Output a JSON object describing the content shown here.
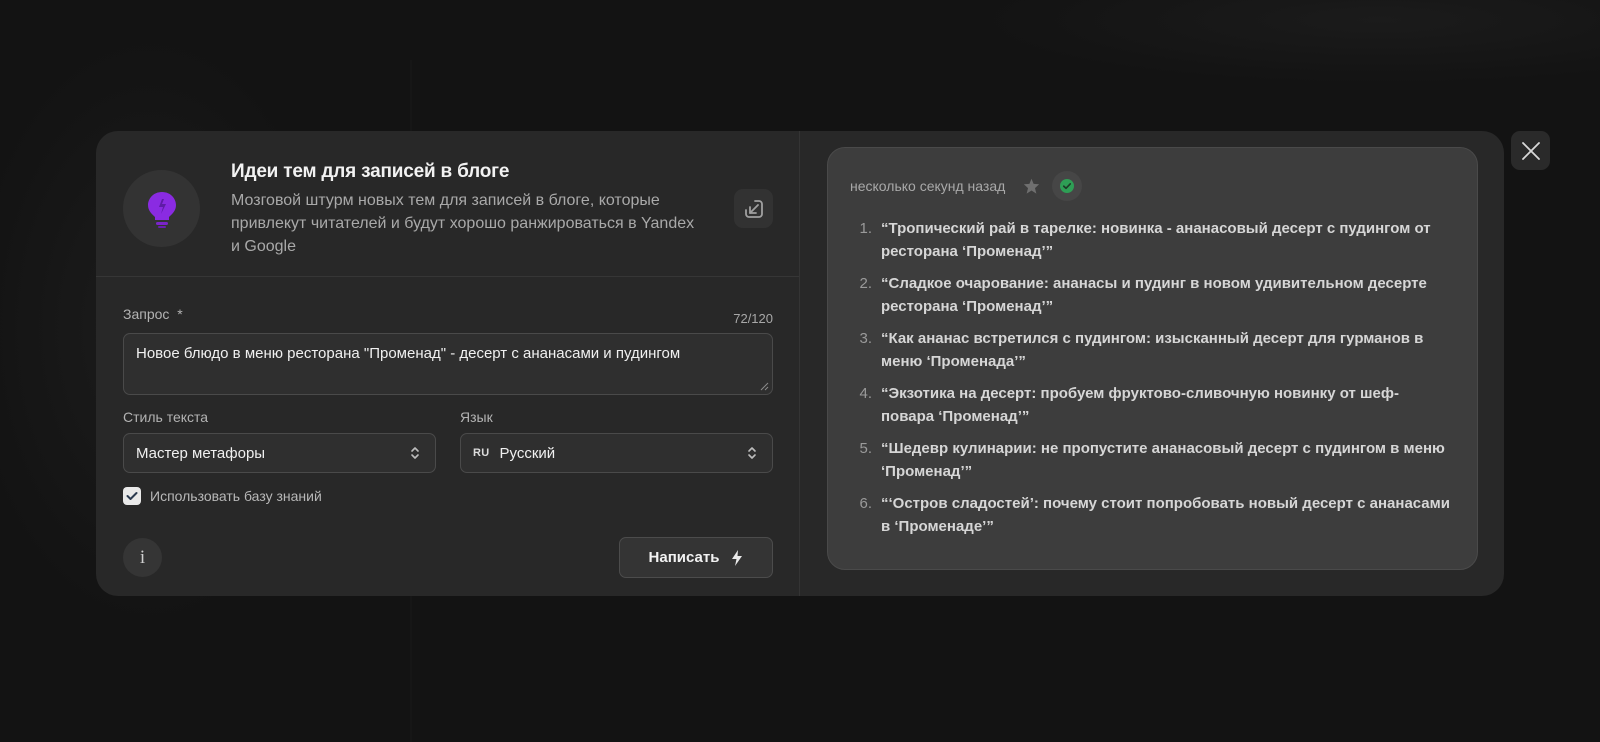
{
  "tool": {
    "title": "Идеи тем для записей в блоге",
    "description": "Мозговой штурм новых тем для записей в блоге, которые привлекут читателей и будут хорошо ранжироваться в Yandex и Google",
    "icon": "lightbulb-icon"
  },
  "form": {
    "request_label": "Запрос",
    "required_mark": "*",
    "counter": "72/120",
    "request_value": "Новое блюдо в меню ресторана \"Променад\" - десерт с ананасами и пудингом",
    "style_label": "Стиль текста",
    "style_value": "Мастер метафоры",
    "language_label": "Язык",
    "language_code": "RU",
    "language_value": "Русский",
    "knowledge_base_label": "Использовать базу знаний",
    "knowledge_base_checked": true,
    "info_label": "i",
    "submit_label": "Написать"
  },
  "result": {
    "timestamp": "несколько секунд назад",
    "items": [
      {
        "num": "1.",
        "text": "“Тропический рай в тарелке: новинка - ананасовый десерт с пудингом от ресторана ‘Променад’”"
      },
      {
        "num": "2.",
        "text": "“Сладкое очарование: ананасы и пудинг в новом удивительном десерте ресторана ‘Променад’”"
      },
      {
        "num": "3.",
        "text": "“Как ананас встретился с пудингом: изысканный десерт для гурманов в меню ‘Променада’”"
      },
      {
        "num": "4.",
        "text": "“Экзотика на десерт: пробуем фруктово-сливочную новинку от шеф-повара ‘Променад’”"
      },
      {
        "num": "5.",
        "text": "“Шедевр кулинарии: не пропустите ананасовый десерт с пудингом в меню ‘Променад’”"
      },
      {
        "num": "6.",
        "text": "“‘Остров сладостей’: почему стоит попробовать новый десерт с ананасами в ‘Променаде’”"
      }
    ]
  },
  "colors": {
    "accent_purple": "#8a2be2",
    "success_green": "#2e9e55",
    "modal_bg": "#282828",
    "result_bg": "#3d3d3d"
  }
}
